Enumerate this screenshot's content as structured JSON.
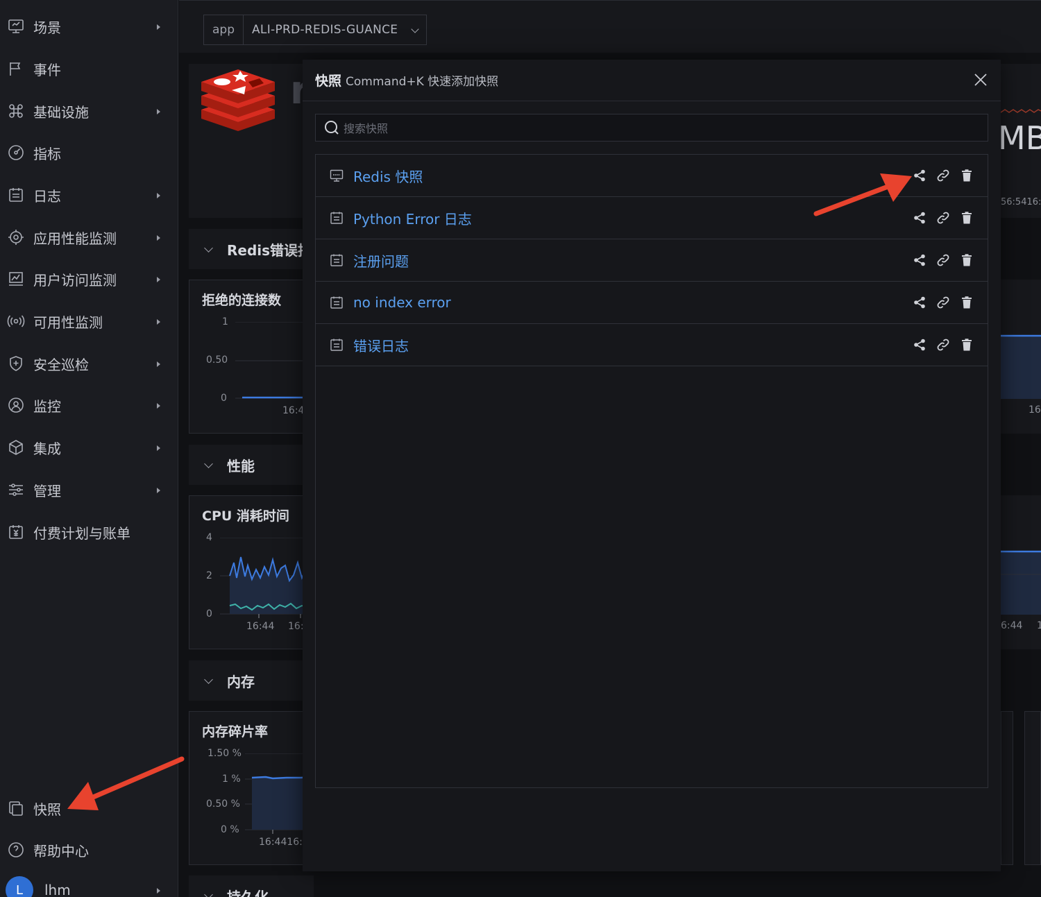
{
  "sidebar": {
    "items": [
      {
        "label": "场景",
        "icon": "monitor-icon",
        "arrow": true
      },
      {
        "label": "事件",
        "icon": "flag-icon",
        "arrow": false
      },
      {
        "label": "基础设施",
        "icon": "command-icon",
        "arrow": true
      },
      {
        "label": "指标",
        "icon": "gauge-icon",
        "arrow": false
      },
      {
        "label": "日志",
        "icon": "log-icon",
        "arrow": true
      },
      {
        "label": "应用性能监测",
        "icon": "target-icon",
        "arrow": true
      },
      {
        "label": "用户访问监测",
        "icon": "chart-board-icon",
        "arrow": true
      },
      {
        "label": "可用性监测",
        "icon": "radio-waves-icon",
        "arrow": true
      },
      {
        "label": "安全巡检",
        "icon": "shield-icon",
        "arrow": true
      },
      {
        "label": "监控",
        "icon": "radar-icon",
        "arrow": true
      },
      {
        "label": "集成",
        "icon": "cube-icon",
        "arrow": true
      },
      {
        "label": "管理",
        "icon": "sliders-icon",
        "arrow": true
      },
      {
        "label": "付费计划与账单",
        "icon": "bill-icon",
        "arrow": false
      }
    ],
    "snapshot_label": "快照",
    "help_label": "帮助中心",
    "user_initial": "L",
    "user_name": "lhm"
  },
  "topbar": {
    "tag_key": "app",
    "tag_value": "ALI-PRD-REDIS-GUANCE"
  },
  "dashboard": {
    "logo_partial": "r",
    "mb_fragment": "MB",
    "time_fragment": "56:5416:5",
    "sections": {
      "redis_errors": "Redis错误指",
      "performance": "性能",
      "memory": "内存",
      "persistence": "持久化"
    },
    "panels": {
      "rejected": {
        "title": "拒绝的连接数",
        "yticks": [
          "1",
          "0.50",
          "0"
        ],
        "xtick": "16:4"
      },
      "cpu": {
        "title": "CPU 消耗时间",
        "yticks": [
          "4",
          "2",
          "0"
        ],
        "xticks": [
          "16:44",
          "16:"
        ],
        "right_xtick": "6:44",
        "right_xtick2": "1"
      },
      "mem_frag": {
        "title": "内存碎片率",
        "yticks": [
          "1.50 %",
          "1 %",
          "0.50 %",
          "0 %"
        ],
        "xtick": "16:4416:4"
      },
      "right_partial_tick": "16:"
    }
  },
  "modal": {
    "title": "快照",
    "subtitle": "Command+K 快速添加快照",
    "search_placeholder": "搜索快照",
    "rows": [
      {
        "label": "Redis 快照",
        "icon": "dashboard-icon"
      },
      {
        "label": "Python Error 日志",
        "icon": "log-icon"
      },
      {
        "label": "注册问题",
        "icon": "log-icon"
      },
      {
        "label": "no index error",
        "icon": "log-icon"
      },
      {
        "label": "错误日志",
        "icon": "log-icon"
      }
    ]
  },
  "colors": {
    "accent_blue": "#5ba0f0",
    "annotation_red": "#e8432e",
    "redis_red": "#c6302b"
  }
}
